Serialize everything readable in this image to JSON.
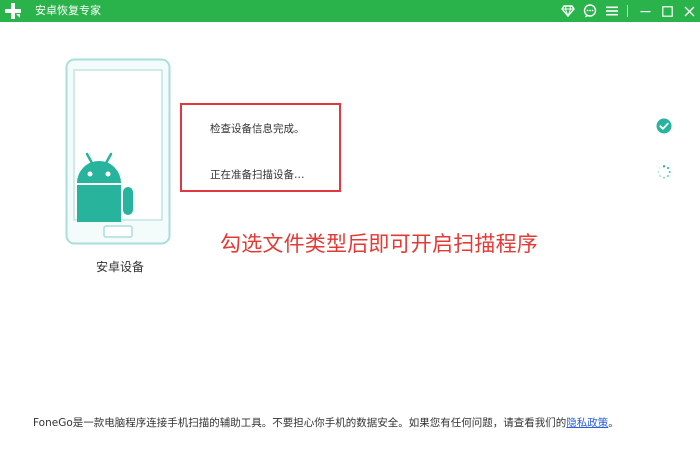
{
  "window": {
    "title": "安卓恢复专家",
    "brand_color": "#2ab34a",
    "icons": [
      "diamond-icon",
      "chat-icon",
      "menu-icon",
      "minimize-icon",
      "maximize-icon",
      "close-icon"
    ]
  },
  "device": {
    "label": "安卓设备",
    "icon": "android-phone-icon"
  },
  "status": {
    "line1": "检查设备信息完成。",
    "line2": "正在准备扫描设备…",
    "line1_icon": "check-circle-icon",
    "line2_icon": "loading-spinner-icon",
    "highlight_color": "#e0383e"
  },
  "annotation": {
    "text": "勾选文件类型后即可开启扫描程序",
    "color": "#e53935"
  },
  "footer": {
    "text": "FoneGo是一款电脑程序连接手机扫描的辅助工具。不要担心你手机的数据安全。如果您有任何问题，请查看我们的",
    "link": "隐私政策",
    "end": "。"
  }
}
